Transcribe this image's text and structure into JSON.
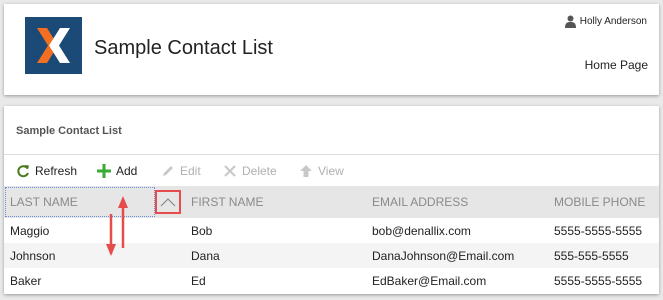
{
  "header": {
    "app_title": "Sample Contact List",
    "user_name": "Holly Anderson",
    "home_link": "Home Page"
  },
  "grid": {
    "title": "Sample Contact List",
    "toolbar": [
      {
        "label": "Refresh",
        "icon": "refresh-icon",
        "enabled": true
      },
      {
        "label": "Add",
        "icon": "plus-icon",
        "enabled": true
      },
      {
        "label": "Edit",
        "icon": "pencil-icon",
        "enabled": false
      },
      {
        "label": "Delete",
        "icon": "close-icon",
        "enabled": false
      },
      {
        "label": "View",
        "icon": "arrow-up-icon",
        "enabled": false
      }
    ],
    "columns": [
      "LAST NAME",
      "FIRST NAME",
      "EMAIL ADDRESS",
      "MOBILE PHONE"
    ],
    "sort": {
      "column": "LAST NAME",
      "direction": "ascending"
    },
    "rows": [
      [
        "Maggio",
        "Bob",
        "bob@denallix.com",
        "5555-5555-5555"
      ],
      [
        "Johnson",
        "Dana",
        "DanaJohnson@Email.com",
        "555-555-5555"
      ],
      [
        "Baker",
        "Ed",
        "EdBaker@Email.com",
        "5555-5555-5555"
      ]
    ]
  },
  "colors": {
    "logo_background": "#1c4a76",
    "logo_orange": "#f26f21",
    "logo_white": "#ffffff",
    "add_green": "#3aaa35",
    "refresh_green": "#4a7a1c",
    "highlight_red": "#e74c4c",
    "header_background": "#e6e6e6",
    "focus_border": "#6a8fd6"
  }
}
